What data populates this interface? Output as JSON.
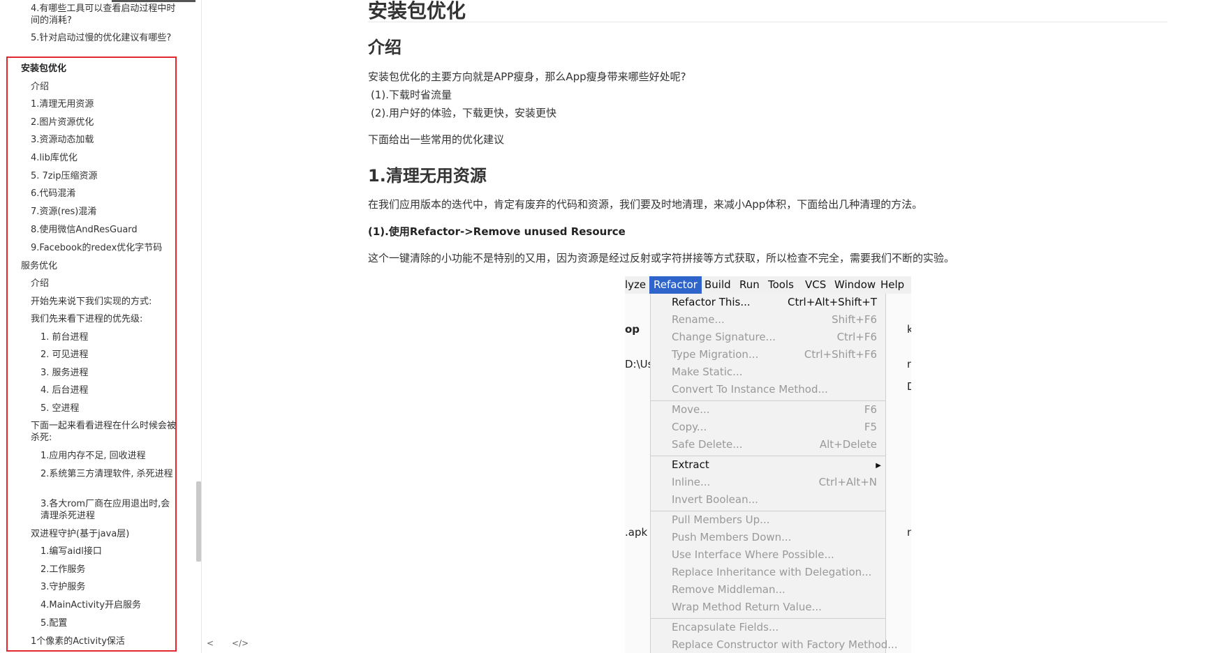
{
  "sidebar": {
    "items": [
      {
        "label": "4.有哪些工具可以查看启动过程中时间的消耗?"
      },
      {
        "label": "5.针对启动过慢的优化建议有哪些?"
      },
      {
        "label": "安装包优化"
      },
      {
        "label": "介绍"
      },
      {
        "label": "1.清理无用资源"
      },
      {
        "label": "2.图片资源优化"
      },
      {
        "label": "3.资源动态加载"
      },
      {
        "label": "4.lib库优化"
      },
      {
        "label": "5. 7zip压缩资源"
      },
      {
        "label": "6.代码混淆"
      },
      {
        "label": "7.资源(res)混淆"
      },
      {
        "label": "8.使用微信AndResGuard"
      },
      {
        "label": "9.Facebook的redex优化字节码"
      },
      {
        "label": "服务优化"
      },
      {
        "label": "介绍"
      },
      {
        "label": "开始先来说下我们实现的方式:"
      },
      {
        "label": "我们先来看下进程的优先级:"
      },
      {
        "label": "1. 前台进程"
      },
      {
        "label": "2. 可见进程"
      },
      {
        "label": "3. 服务进程"
      },
      {
        "label": "4. 后台进程"
      },
      {
        "label": "5. 空进程"
      },
      {
        "label": "下面一起来看看进程在什么时候会被杀死:"
      },
      {
        "label": "1.应用内存不足, 回收进程"
      },
      {
        "label": "2.系统第三方清理软件, 杀死进程"
      },
      {
        "label": "3.各大rom厂商在应用退出时,会清理杀死进程"
      },
      {
        "label": "双进程守护(基于java层)"
      },
      {
        "label": "1.编写aidl接口"
      },
      {
        "label": "2.工作服务"
      },
      {
        "label": "3.守护服务"
      },
      {
        "label": "4.MainActivity开启服务"
      },
      {
        "label": "5.配置"
      },
      {
        "label": "1个像素的Activity保活"
      }
    ],
    "footer": {
      "collapse": "<",
      "source": "</>"
    }
  },
  "main": {
    "title": "安装包优化",
    "intro_heading": "介绍",
    "intro_lines": [
      "安装包优化的主要方向就是APP瘦身，那么App瘦身带来哪些好处呢?",
      "(1).下载时省流量",
      "(2).用户好的体验，下载更快，安装更快",
      "下面给出一些常用的优化建议"
    ],
    "section1_heading": "1.清理无用资源",
    "section1_para": "在我们应用版本的迭代中，肯定有废弃的代码和资源，我们要及时地清理，来减小App体积，下面给出几种清理的方法。",
    "section1_sub": "(1).使用Refactor->Remove unused Resource",
    "section1_para2": "这个一键清除的小功能不是特别的又用，因为资源是经过反射或字符拼接等方式获取，所以检查不完全，需要我们不断的实验。"
  },
  "ide": {
    "menubar": [
      "lyze",
      "Refactor",
      "Build",
      "Run",
      "Tools",
      "VCS",
      "Window",
      "Help"
    ],
    "left_bits": [
      "op",
      "D:\\Us",
      ".apk"
    ],
    "right_bits": [
      "k",
      "n",
      "D",
      "n"
    ],
    "menu_items": [
      {
        "label": "Refactor This...",
        "shortcut": "Ctrl+Alt+Shift+T",
        "enabled": true
      },
      {
        "label": "Rename...",
        "shortcut": "Shift+F6",
        "enabled": false
      },
      {
        "label": "Change Signature...",
        "shortcut": "Ctrl+F6",
        "enabled": false
      },
      {
        "label": "Type Migration...",
        "shortcut": "Ctrl+Shift+F6",
        "enabled": false
      },
      {
        "label": "Make Static...",
        "shortcut": "",
        "enabled": false
      },
      {
        "label": "Convert To Instance Method...",
        "shortcut": "",
        "enabled": false
      },
      {
        "label": "Move...",
        "shortcut": "F6",
        "enabled": false
      },
      {
        "label": "Copy...",
        "shortcut": "F5",
        "enabled": false
      },
      {
        "label": "Safe Delete...",
        "shortcut": "Alt+Delete",
        "enabled": false
      },
      {
        "label": "Extract",
        "shortcut": "",
        "enabled": true
      },
      {
        "label": "Inline...",
        "shortcut": "Ctrl+Alt+N",
        "enabled": false
      },
      {
        "label": "Invert Boolean...",
        "shortcut": "",
        "enabled": false
      },
      {
        "label": "Pull Members Up...",
        "shortcut": "",
        "enabled": false
      },
      {
        "label": "Push Members Down...",
        "shortcut": "",
        "enabled": false
      },
      {
        "label": "Use Interface Where Possible...",
        "shortcut": "",
        "enabled": false
      },
      {
        "label": "Replace Inheritance with Delegation...",
        "shortcut": "",
        "enabled": false
      },
      {
        "label": "Remove Middleman...",
        "shortcut": "",
        "enabled": false
      },
      {
        "label": "Wrap Method Return Value...",
        "shortcut": "",
        "enabled": false
      },
      {
        "label": "Encapsulate Fields...",
        "shortcut": "",
        "enabled": false
      },
      {
        "label": "Replace Constructor with Factory Method...",
        "shortcut": "",
        "enabled": false
      }
    ]
  },
  "colors": {
    "highlight_border": "#e3282f",
    "menu_active": "#2f65ca"
  }
}
